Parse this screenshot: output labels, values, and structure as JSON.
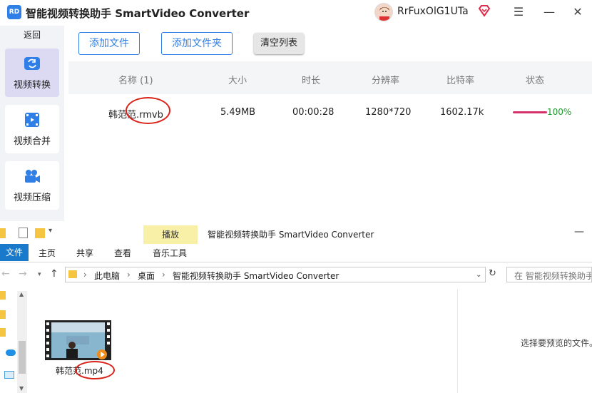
{
  "app": {
    "title": "智能视频转换助手 SmartVideo Converter",
    "logo_text": "RD",
    "username": "RrFuxOlG1UTa",
    "menu_icon": "hamburger-icon",
    "minimize_icon": "minimize-icon",
    "close_icon": "close-icon"
  },
  "sidebar": {
    "back_label": "返回",
    "items": [
      {
        "label": "视频转换",
        "icon": "video-convert-icon",
        "active": true
      },
      {
        "label": "视频合并",
        "icon": "video-merge-icon",
        "active": false
      },
      {
        "label": "视频压缩",
        "icon": "video-compress-icon",
        "active": false
      }
    ]
  },
  "toolbar": {
    "add_file": "添加文件",
    "add_folder": "添加文件夹",
    "clear_list": "清空列表"
  },
  "table": {
    "headers": [
      "名称 (1)",
      "大小",
      "时长",
      "分辨率",
      "比特率",
      "状态"
    ],
    "rows": [
      {
        "name": "韩范范.rmvb",
        "size": "5.49MB",
        "duration": "00:00:28",
        "resolution": "1280*720",
        "bitrate": "1602.17k",
        "status": "100%",
        "progress": 1.0
      }
    ]
  },
  "explorer": {
    "context_tab": "播放",
    "title": "智能视频转换助手 SmartVideo Converter",
    "menu": [
      "文件",
      "主页",
      "共享",
      "查看",
      "音乐工具"
    ],
    "address": [
      "此电脑",
      "桌面",
      "智能视频转换助手 SmartVideo Converter"
    ],
    "search_placeholder": "在 智能视频转换助手 SmartVideo Converter 中搜索",
    "file_name": "韩范范.mp4",
    "preview_hint": "选择要预览的文件。"
  },
  "colors": {
    "accent": "#2f7fe6",
    "progress": "#d6306a",
    "status_text": "#1a9c2a",
    "annotation": "#d9231a"
  }
}
